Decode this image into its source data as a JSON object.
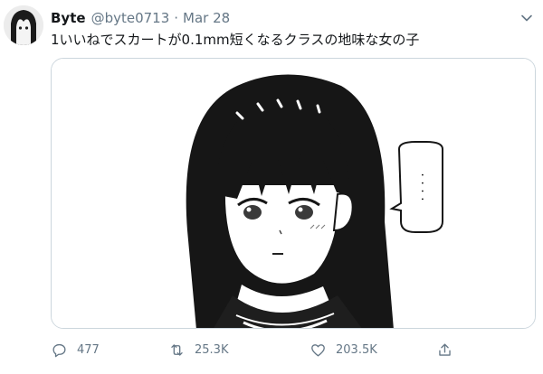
{
  "author": {
    "display_name": "Byte",
    "handle": "@byte0713",
    "separator": "·",
    "date": "Mar 28"
  },
  "tweet": {
    "text": "1いいねでスカートが0.1mm短くなるクラスの地味な女の子"
  },
  "media": {
    "speech_bubble_text": ". . . ."
  },
  "actions": {
    "reply_count": "477",
    "retweet_count": "25.3K",
    "like_count": "203.5K"
  },
  "colors": {
    "text_primary": "#14171a",
    "text_secondary": "#657786",
    "border": "#ccd6dd"
  },
  "icons": {
    "menu": "chevron-down-icon",
    "reply": "comment-icon",
    "retweet": "retweet-icon",
    "like": "heart-icon",
    "share": "share-icon"
  }
}
